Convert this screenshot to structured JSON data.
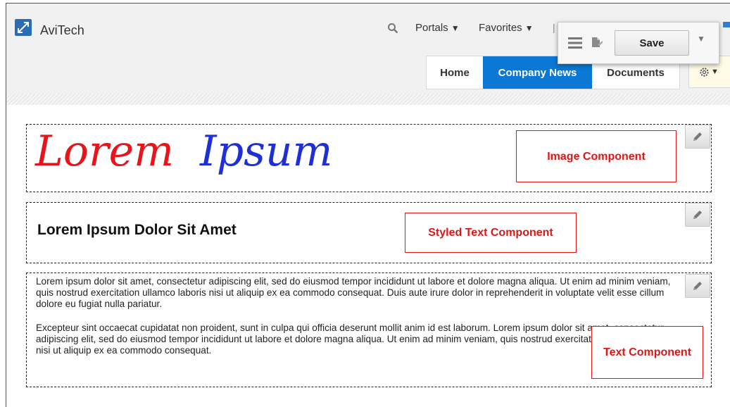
{
  "app": {
    "title": "AviTech"
  },
  "header": {
    "portals_label": "Portals",
    "favorites_label": "Favorites",
    "separator": "|"
  },
  "toolbar": {
    "save_label": "Save"
  },
  "tabs": [
    {
      "label": "Home",
      "active": false
    },
    {
      "label": "Company News",
      "active": true
    },
    {
      "label": "Documents",
      "active": false
    }
  ],
  "colors": {
    "accent": "#0a78d4",
    "brand": "#2b6cb6",
    "annotation": "#e01515",
    "lorem_red": "#e8141b",
    "ipsum_blue": "#1f2fd6"
  },
  "image_component": {
    "word1": "Lorem",
    "word2": "Ipsum"
  },
  "styled_text_component": {
    "heading": "Lorem Ipsum Dolor Sit Amet"
  },
  "text_component": {
    "paragraph1": "Lorem ipsum dolor sit amet, consectetur adipiscing elit, sed do eiusmod tempor incididunt ut labore et dolore magna aliqua. Ut enim ad minim veniam, quis nostrud exercitation ullamco laboris nisi ut aliquip ex ea commodo consequat. Duis aute irure dolor in reprehenderit in voluptate velit esse cillum dolore eu fugiat nulla pariatur.",
    "paragraph2": "Excepteur sint occaecat cupidatat non proident, sunt in culpa qui officia deserunt mollit anim id est laborum. Lorem ipsum dolor sit amet, consectetur adipiscing elit, sed do eiusmod tempor incididunt ut labore et dolore magna aliqua. Ut enim ad minim veniam, quis nostrud exercitation ullamco laboris nisi ut aliquip ex ea commodo consequat."
  },
  "annotations": {
    "image": "Image Component",
    "styled_text": "Styled Text Component",
    "text": "Text Component"
  }
}
